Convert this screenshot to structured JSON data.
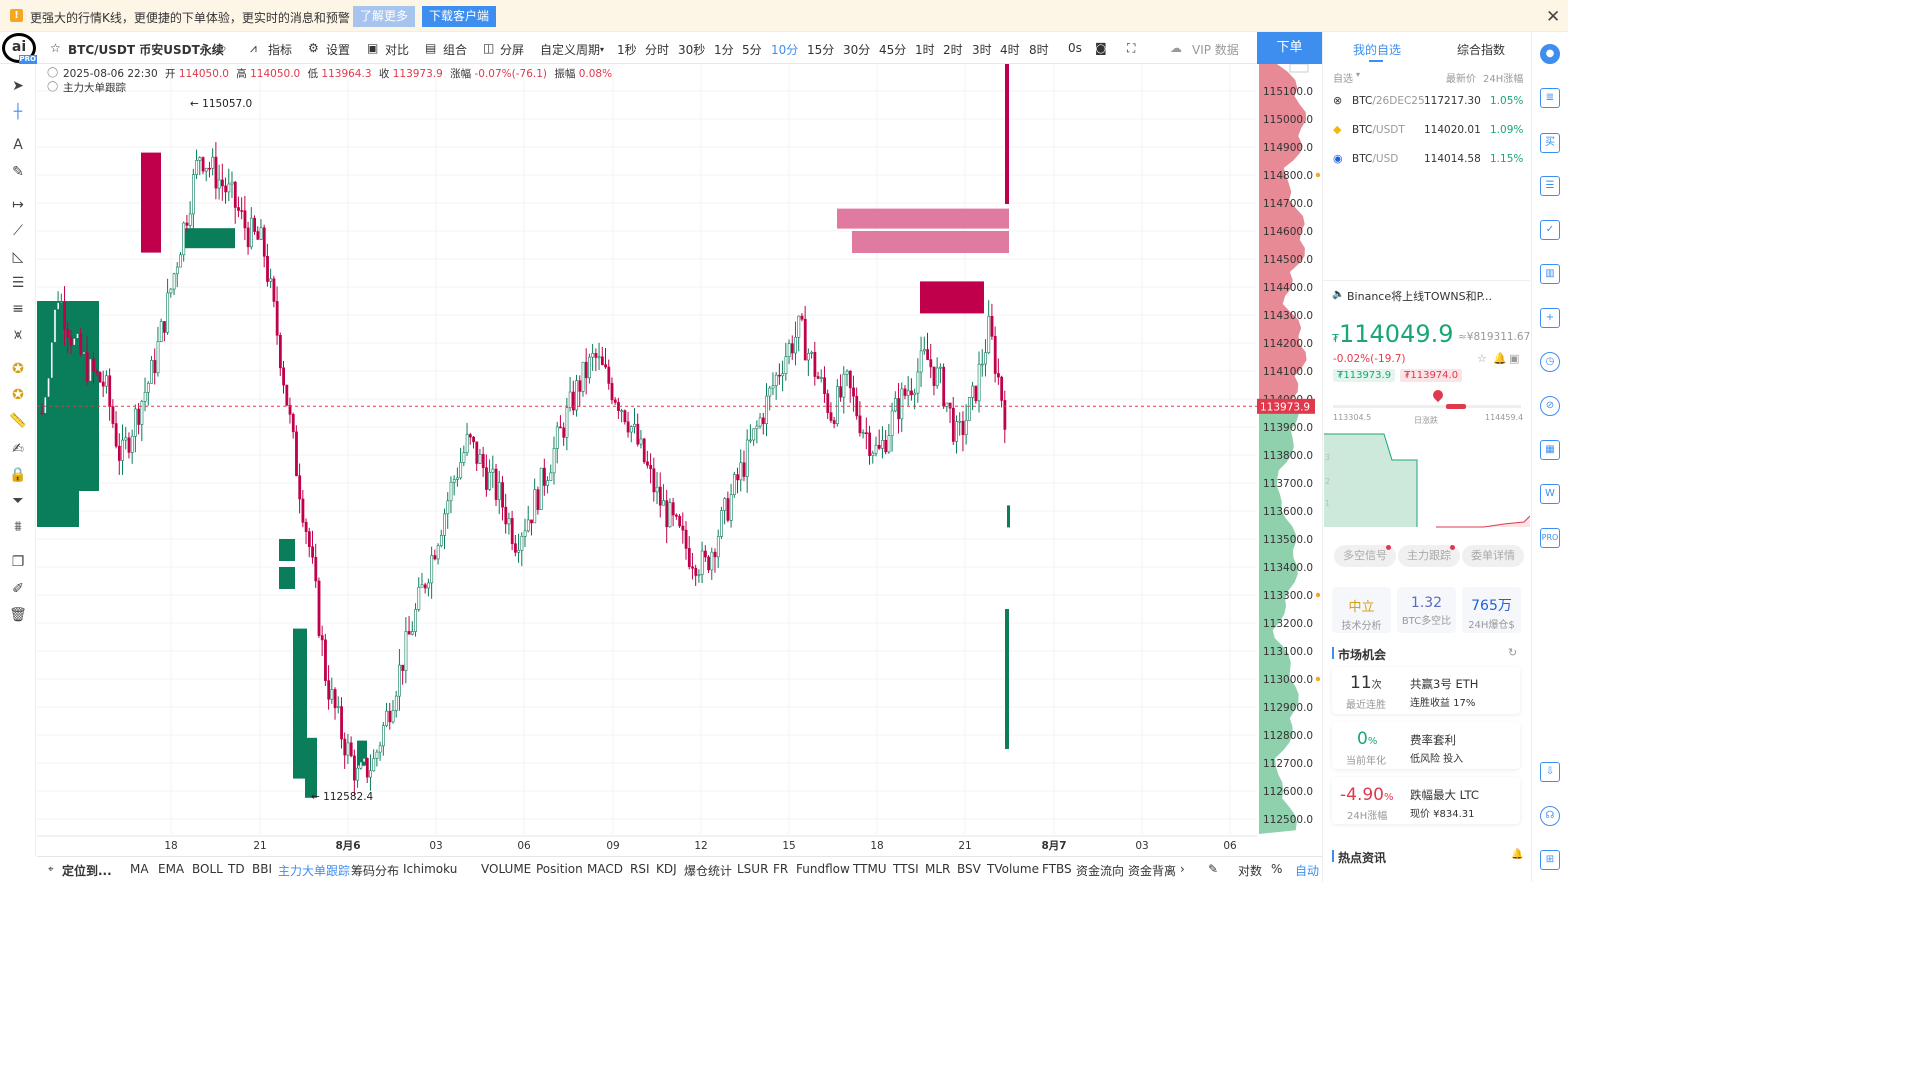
{
  "banner": {
    "message": "更强大的行情K线，更便捷的下单体验，更实时的消息和预警",
    "learn_more": "了解更多",
    "download": "下载客户端"
  },
  "toolbar": {
    "symbol": "BTC/USDT 币安USDT永续",
    "indicators": "指标",
    "settings": "设置",
    "compare": "对比",
    "combo": "组合",
    "split": "分屏",
    "custom_period": "自定义周期",
    "periods": [
      "1秒",
      "分时",
      "30秒",
      "1分",
      "5分",
      "10分",
      "15分",
      "30分",
      "45分",
      "1时",
      "2时",
      "3时",
      "4时",
      "8时"
    ],
    "selected_period": "10分",
    "countdown": "0s",
    "vip": "VIP 数据",
    "order": "下单"
  },
  "ohlc": {
    "time": "2025-08-06 22:30",
    "open_label": "开",
    "open": "114050.0",
    "high_label": "高",
    "high": "114050.0",
    "low_label": "低",
    "low": "113964.3",
    "close_label": "收",
    "close": "113973.9",
    "change_label": "涨幅",
    "change": "-0.07%(-76.1)",
    "amp_label": "振幅",
    "amp": "0.08%",
    "overlay": "主力大单跟踪"
  },
  "chart_data": {
    "type": "candlestick",
    "symbol": "BTC/USDT",
    "interval": "10分",
    "ylim": [
      112450,
      115200
    ],
    "y_ticks": [
      115100,
      115000,
      114900,
      114800,
      114700,
      114600,
      114500,
      114400,
      114300,
      114200,
      114100,
      114000,
      113900,
      113800,
      113700,
      113600,
      113500,
      113400,
      113300,
      113200,
      113100,
      113000,
      112900,
      112800,
      112700,
      112600,
      112500
    ],
    "x_ticks": [
      "18",
      "21",
      "8月6",
      "03",
      "06",
      "09",
      "12",
      "15",
      "18",
      "21",
      "8月7",
      "03",
      "06"
    ],
    "current_price": "113973.9",
    "annotations": [
      {
        "label": "115057.0",
        "value": 115057.0
      },
      {
        "label": "112582.4",
        "value": 112582.4
      }
    ],
    "close_path": [
      113950,
      114380,
      114200,
      114100,
      114050,
      113780,
      113950,
      114100,
      114350,
      114620,
      114880,
      114800,
      114720,
      114600,
      114550,
      114200,
      113800,
      113450,
      113000,
      112800,
      112650,
      112700,
      112900,
      113100,
      113300,
      113500,
      113700,
      113850,
      113750,
      113650,
      113500,
      113600,
      113750,
      113900,
      114050,
      114150,
      114050,
      113950,
      113800,
      113650,
      113550,
      113450,
      113400,
      113550,
      113700,
      113850,
      114000,
      114150,
      114250,
      114100,
      113950,
      114050,
      113900,
      113800,
      113950,
      114050,
      114150,
      114050,
      113850,
      114000,
      114250,
      113950
    ]
  },
  "order_book": {
    "sell_color": "#c0004a",
    "buy_color": "#0a7d5b"
  },
  "bottom": {
    "locate": "定位到...",
    "indicators": [
      "MA",
      "EMA",
      "BOLL",
      "TD",
      "BBI",
      "主力大单跟踪",
      "筹码分布",
      "Ichimoku"
    ],
    "selected_indicator": "主力大单跟踪",
    "subs": [
      "VOLUME",
      "Position",
      "MACD",
      "RSI",
      "KDJ",
      "爆仓统计",
      "LSUR",
      "FR",
      "Fundflow",
      "TTMU",
      "TTSI",
      "MLR",
      "BSV",
      "TVolume",
      "FTBS",
      "资金流向",
      "资金背离"
    ],
    "log": "对数",
    "percent": "%",
    "auto": "自动"
  },
  "right": {
    "tab_watch": "我的自选",
    "tab_index": "综合指数",
    "col_self": "自选",
    "col_price": "最新价",
    "col_change": "24H涨幅",
    "watchlist": [
      {
        "sym": "BTC",
        "sub": "/26DEC25",
        "price": "117217.30",
        "chg": "1.05%"
      },
      {
        "sym": "BTC",
        "sub": "/USDT",
        "price": "114020.01",
        "chg": "1.09%"
      },
      {
        "sym": "BTC",
        "sub": "/USD",
        "price": "114014.58",
        "chg": "1.15%"
      }
    ],
    "news": "Binance将上线TOWNS和P...",
    "price_symbol": "₮",
    "price": "114049.9",
    "price_cny": "≈¥819311.67",
    "price_change": "-0.02%(-19.7)",
    "bid": "₮113973.9",
    "ask": "₮113974.0",
    "range_low": "113304.5",
    "range_mid": "日涨跌",
    "range_high": "114459.4",
    "depth_y": [
      "3",
      "2",
      "1"
    ],
    "tags": [
      "多空信号",
      "主力跟踪",
      "委单详情"
    ],
    "cards": [
      {
        "value": "中立",
        "label": "技术分析"
      },
      {
        "value": "1.32",
        "label": "BTC多空比"
      },
      {
        "value": "765万",
        "label": "24H爆仓$"
      }
    ],
    "opportunity_title": "市场机会",
    "opportunities": [
      {
        "big": "11",
        "unit": "次",
        "sub": "最近连胜",
        "title": "共赢3号 ETH",
        "desc": "连胜收益 17%"
      },
      {
        "big": "0",
        "unit": "%",
        "sub": "当前年化",
        "title": "费率套利",
        "desc": "低风险 投入"
      },
      {
        "big": "-4.90",
        "unit": "%",
        "sub": "24H涨幅",
        "title": "跌幅最大 LTC",
        "desc": "现价 ¥834.31"
      }
    ],
    "hot_title": "热点资讯"
  }
}
